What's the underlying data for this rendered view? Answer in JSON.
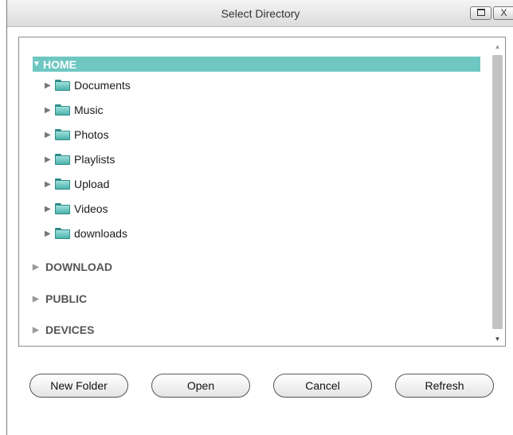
{
  "window": {
    "title": "Select Directory",
    "maximize_icon": "maximize-icon",
    "close_label": "X"
  },
  "tree": {
    "home": {
      "label": "HOME",
      "expanded": true,
      "selected": true
    },
    "home_children": [
      {
        "label": "Documents"
      },
      {
        "label": "Music"
      },
      {
        "label": "Photos"
      },
      {
        "label": "Playlists"
      },
      {
        "label": "Upload"
      },
      {
        "label": "Videos"
      },
      {
        "label": "downloads"
      }
    ],
    "roots": [
      {
        "label": "DOWNLOAD"
      },
      {
        "label": "PUBLIC"
      },
      {
        "label": "DEVICES"
      }
    ]
  },
  "buttons": {
    "new_folder": "New Folder",
    "open": "Open",
    "cancel": "Cancel",
    "refresh": "Refresh"
  },
  "colors": {
    "selection": "#6fc7c2",
    "folder": "#4db3ad"
  }
}
